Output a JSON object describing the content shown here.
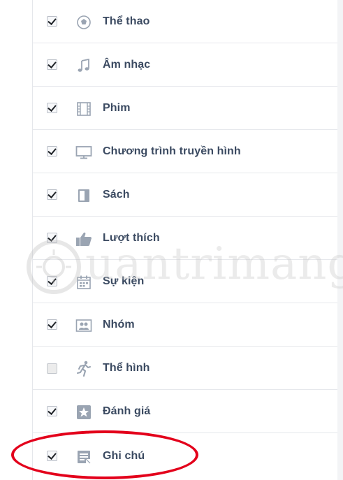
{
  "items": [
    {
      "label": "Thể thao",
      "checked": true,
      "icon": "sports-ball-icon"
    },
    {
      "label": "Âm nhạc",
      "checked": true,
      "icon": "music-note-icon"
    },
    {
      "label": "Phim",
      "checked": true,
      "icon": "film-icon"
    },
    {
      "label": "Chương trình truyền hình",
      "checked": true,
      "icon": "tv-icon"
    },
    {
      "label": "Sách",
      "checked": true,
      "icon": "book-icon"
    },
    {
      "label": "Lượt thích",
      "checked": true,
      "icon": "thumbs-up-icon"
    },
    {
      "label": "Sự kiện",
      "checked": true,
      "icon": "calendar-icon"
    },
    {
      "label": "Nhóm",
      "checked": true,
      "icon": "group-icon"
    },
    {
      "label": "Thể hình",
      "checked": false,
      "icon": "running-person-icon"
    },
    {
      "label": "Đánh giá",
      "checked": true,
      "icon": "star-icon"
    },
    {
      "label": "Ghi chú",
      "checked": true,
      "icon": "notes-icon"
    }
  ],
  "colors": {
    "label": "#3b4a61",
    "icon": "#9aa4b2",
    "highlight": "#e3001b"
  }
}
